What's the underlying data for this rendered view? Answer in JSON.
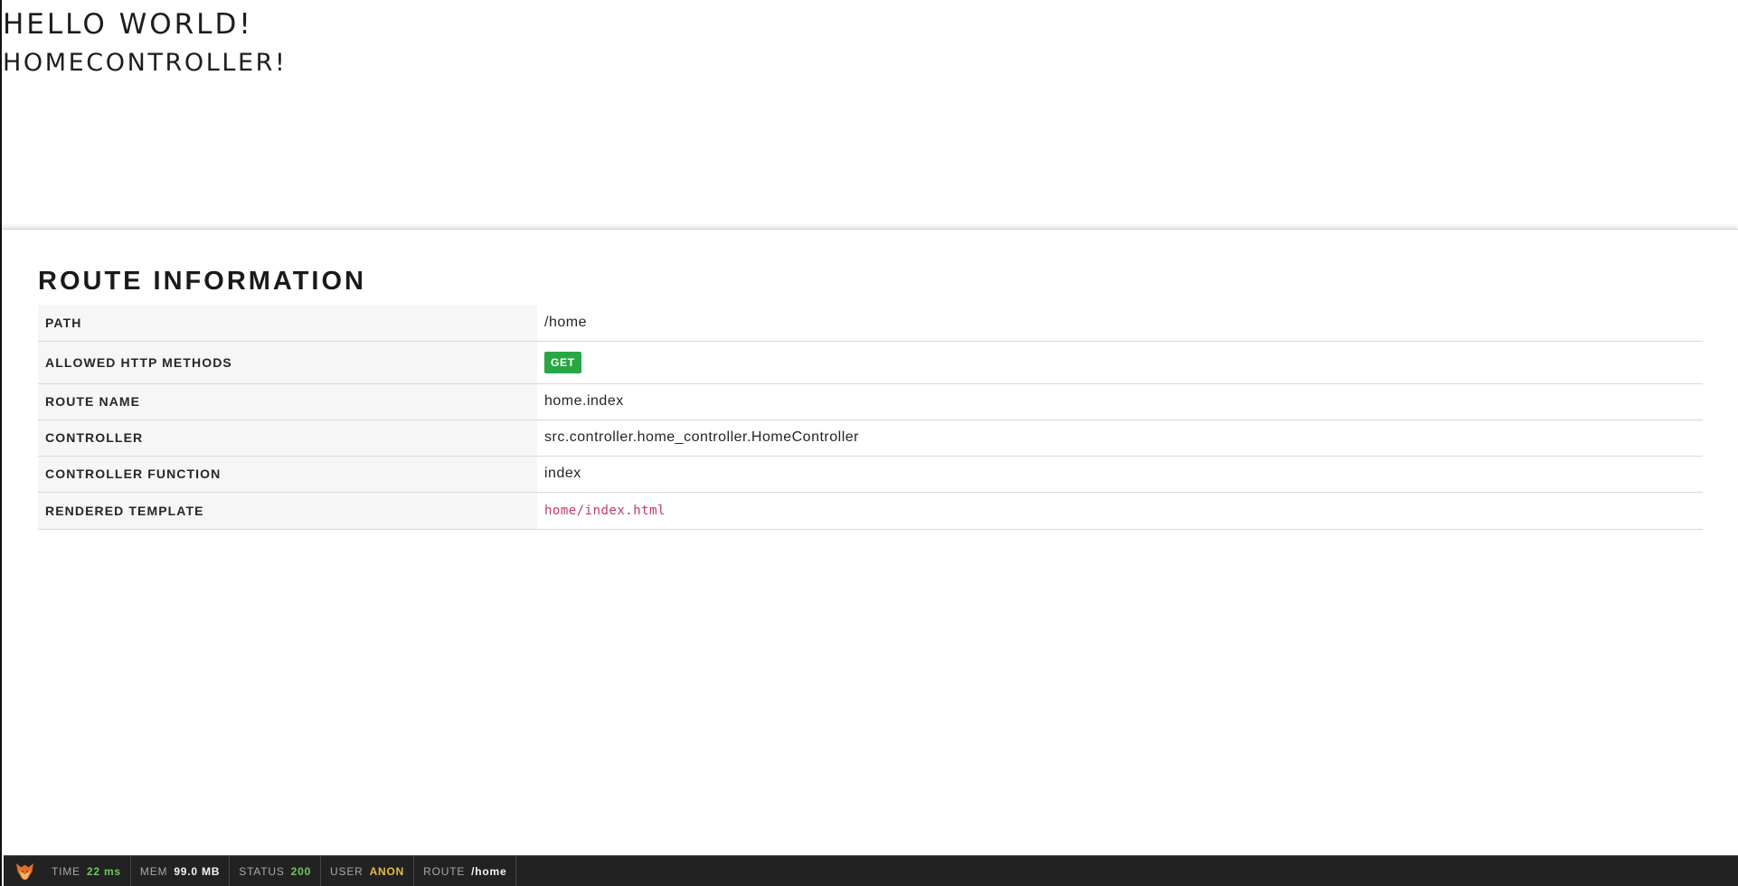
{
  "app": {
    "title": "HELLO WORLD!",
    "subtitle": "HOMECONTROLLER!"
  },
  "route_info": {
    "title": "ROUTE INFORMATION",
    "rows": [
      {
        "label": "PATH",
        "value": "/home"
      },
      {
        "label": "ALLOWED HTTP METHODS",
        "value": "GET"
      },
      {
        "label": "ROUTE NAME",
        "value": "home.index"
      },
      {
        "label": "CONTROLLER",
        "value": "src.controller.home_controller.HomeController"
      },
      {
        "label": "CONTROLLER FUNCTION",
        "value": "index"
      },
      {
        "label": "RENDERED TEMPLATE",
        "value": "home/index.html"
      }
    ]
  },
  "toolbar": {
    "logo_icon": "fox-logo-icon",
    "items": [
      {
        "label": "TIME",
        "value": "22 ms",
        "color": "#74c465"
      },
      {
        "label": "MEM",
        "value": "99.0 MB",
        "color": "#f5f5f5"
      },
      {
        "label": "STATUS",
        "value": "200",
        "color": "#74c465"
      },
      {
        "label": "USER",
        "value": "ANON",
        "color": "#e8bb48"
      },
      {
        "label": "ROUTE",
        "value": "/home",
        "color": "#f5f5f5"
      }
    ]
  },
  "colors": {
    "method_get": "#28a745",
    "template_text": "#c3386b",
    "toolbar_background": "#222222"
  }
}
